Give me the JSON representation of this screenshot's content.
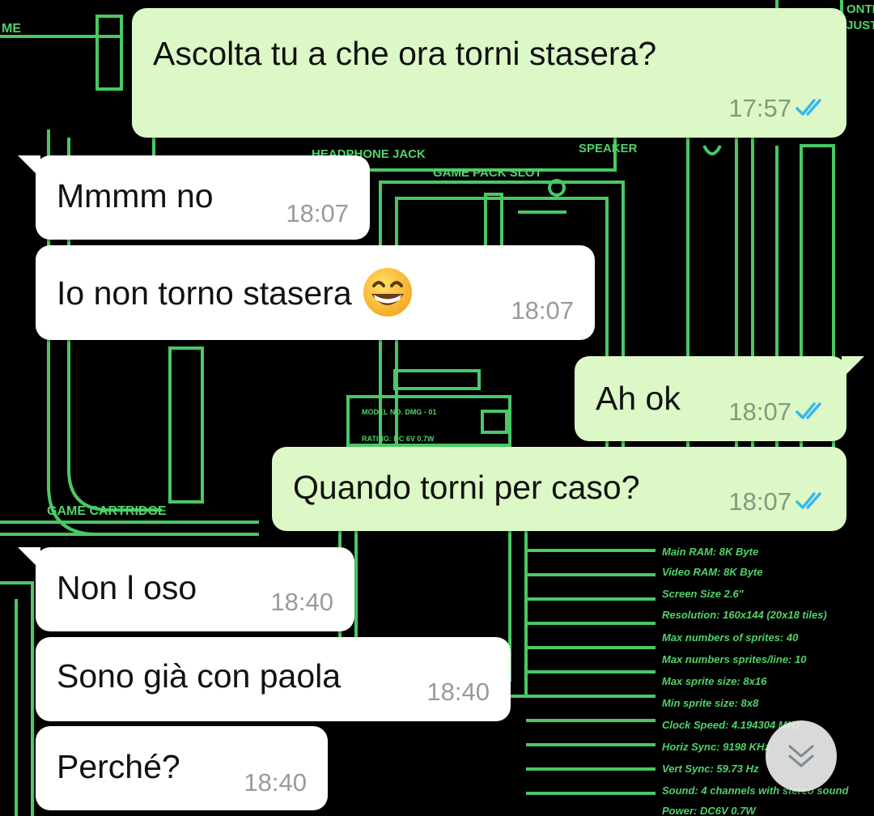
{
  "colors": {
    "wallpaper": "#000000",
    "wallpaper_lines": "#4fd36a",
    "incoming_bubble": "#ffffff",
    "outgoing_bubble": "#dcf8c6",
    "read_ticks": "#34b7f1"
  },
  "wallpaper": {
    "labels": {
      "l1": "ME",
      "l2": "ONTR",
      "l3": "JUST",
      "headphone": "HEADPHONE JACK",
      "speaker": "SPEAKER",
      "game_pack": "GAME PACK SLOT",
      "cartridge": "GAME CARTRIDGE",
      "model": "MODEL NO.  DMG - 01",
      "rating": "RATING: DC 6V  0.7W"
    },
    "specs": [
      "Main RAM: 8K Byte",
      "Video RAM: 8K Byte",
      "Screen Size 2.6\"",
      "Resolution: 160x144 (20x18 tiles)",
      "Max numbers of sprites: 40",
      "Max numbers sprites/line: 10",
      "Max sprite size: 8x16",
      "Min sprite size: 8x8",
      "Clock Speed: 4.194304 MHz",
      "Horiz Sync: 9198 KHz",
      "Vert Sync: 59.73 Hz",
      "Sound: 4 channels with stereo sound",
      "Power: DC6V 0.7W"
    ]
  },
  "messages": [
    {
      "direction": "out",
      "text": "Ascolta tu a che ora torni stasera?",
      "time": "17:57",
      "status_icon": "double-check-read-icon"
    },
    {
      "direction": "in",
      "text": "Mmmm no",
      "time": "18:07"
    },
    {
      "direction": "in",
      "text": "Io non torno stasera",
      "emoji": "grinning-face-icon",
      "time": "18:07"
    },
    {
      "direction": "out",
      "text": "Ah ok",
      "time": "18:07",
      "status_icon": "double-check-read-icon"
    },
    {
      "direction": "out",
      "text": "Quando torni per caso?",
      "time": "18:07",
      "status_icon": "double-check-read-icon"
    },
    {
      "direction": "in",
      "text": "Non l oso",
      "time": "18:40"
    },
    {
      "direction": "in",
      "text": "Sono già con paola",
      "time": "18:40"
    },
    {
      "direction": "in",
      "text": "Perché?",
      "time": "18:40"
    }
  ],
  "scroll_button": {
    "icon": "chevron-double-down-icon"
  }
}
